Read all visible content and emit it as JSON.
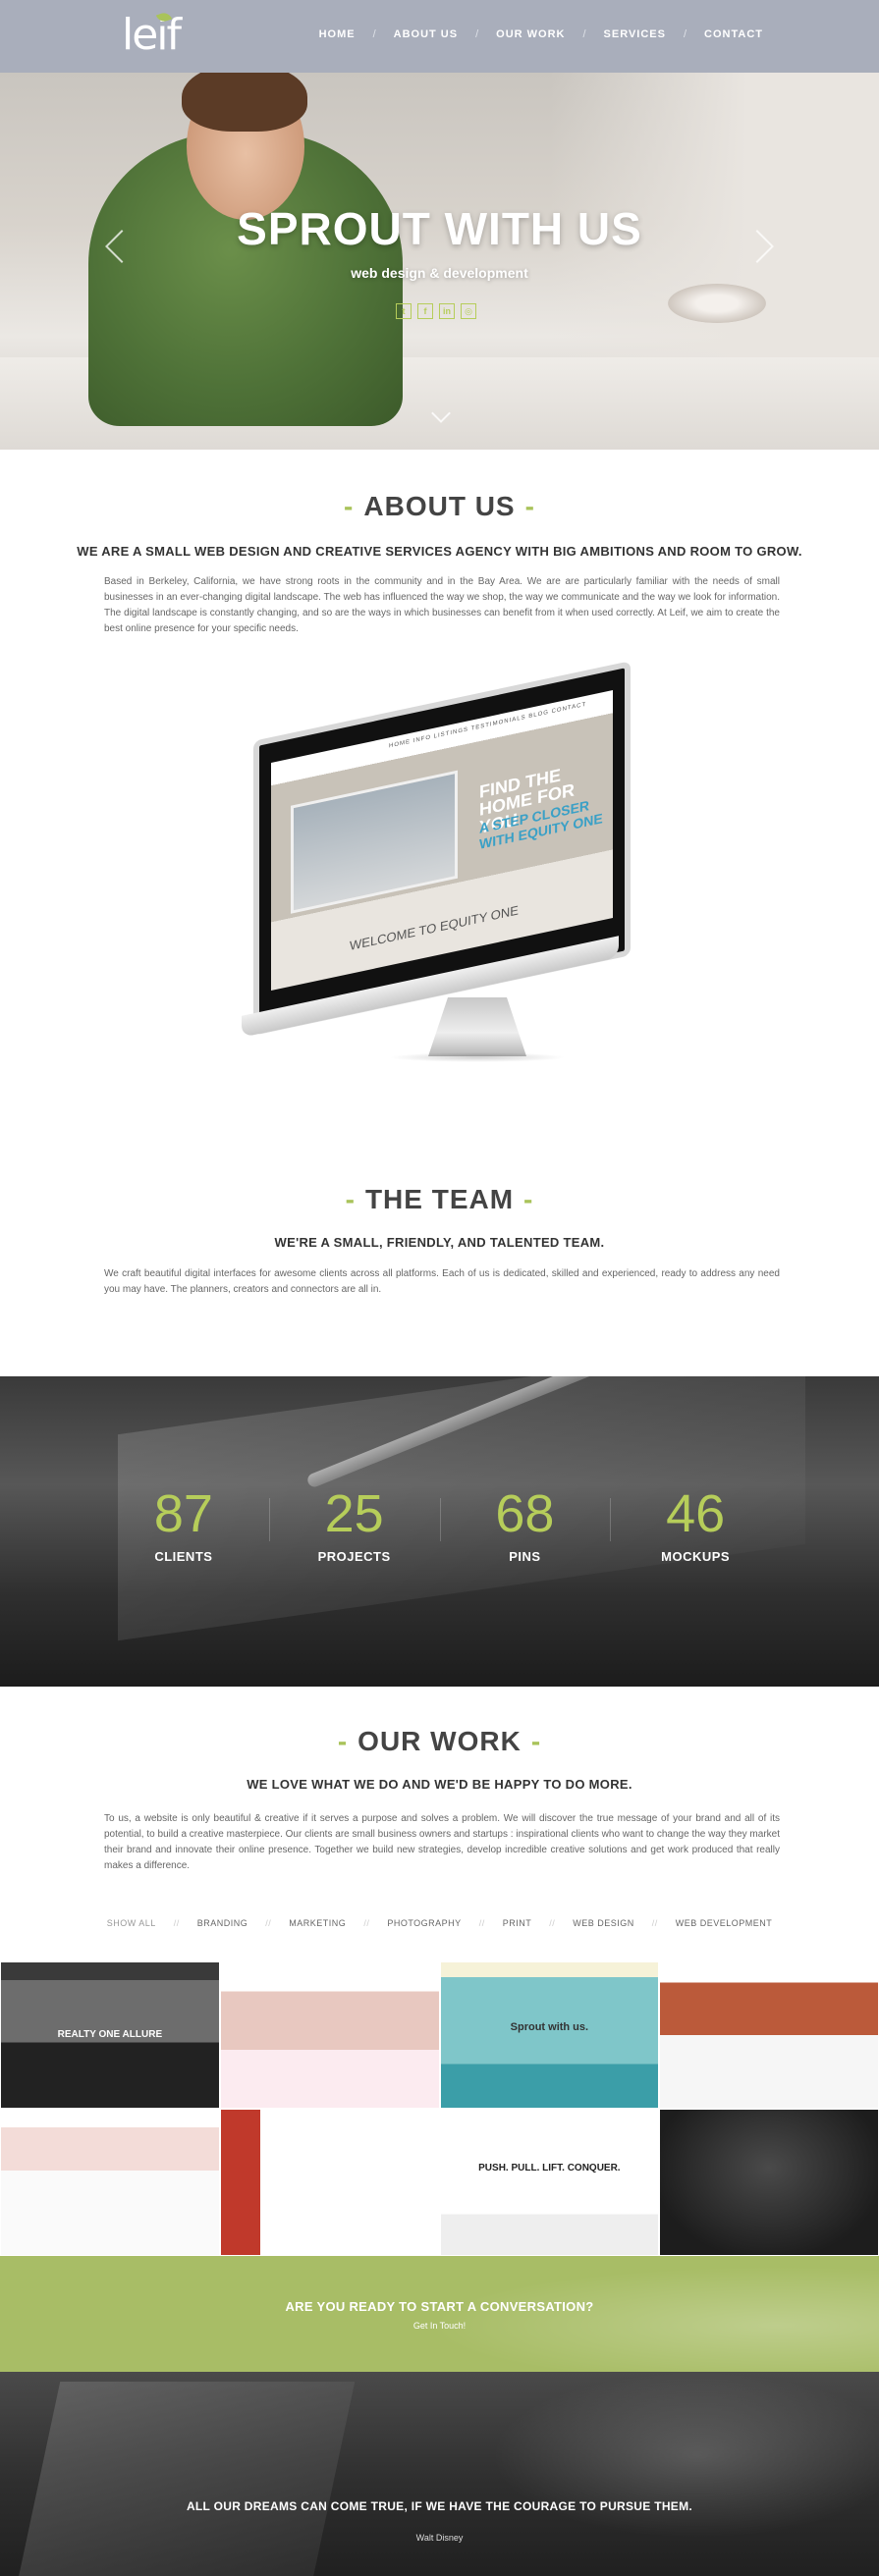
{
  "brand": {
    "logo_text": "leif",
    "accent_color": "#a9c35a"
  },
  "nav": {
    "items": [
      "HOME",
      "ABOUT US",
      "OUR WORK",
      "SERVICES",
      "CONTACT"
    ],
    "separator": "/"
  },
  "hero": {
    "title": "SPROUT WITH US",
    "subtitle": "web design & development",
    "social_icons": [
      "twitter-icon",
      "facebook-icon",
      "linkedin-icon",
      "instagram-icon"
    ],
    "social_glyphs": [
      "t",
      "f",
      "in",
      "◎"
    ]
  },
  "about": {
    "title": "ABOUT US",
    "subtitle": "WE ARE A SMALL WEB DESIGN AND CREATIVE SERVICES AGENCY WITH BIG AMBITIONS AND ROOM TO GROW.",
    "body": "Based in Berkeley, California, we have strong roots in the community and in the Bay Area. We are are particularly familiar with the needs of small businesses in an ever-changing digital landscape. The web has influenced the way we shop, the way we communicate and the way we look for information. The digital landscape is constantly changing, and so are the ways in which businesses can benefit from it when used correctly. At Leif, we aim to create the best online presence for your specific needs.",
    "showcase": {
      "nav": "HOME   INFO   LISTINGS   TESTIMONIALS   BLOG   CONTACT",
      "headline": "FIND THE HOME FOR YOU",
      "tagline": "A STEP CLOSER WITH EQUITY ONE",
      "welcome": "WELCOME TO EQUITY ONE"
    }
  },
  "team": {
    "title": "THE TEAM",
    "subtitle": "WE'RE A SMALL, FRIENDLY, AND TALENTED TEAM.",
    "body": "We craft beautiful digital interfaces for awesome clients across all platforms. Each of us is dedicated, skilled and experienced, ready to address any need you may have. The planners, creators and connectors are all in."
  },
  "stats": [
    {
      "value": "87",
      "label": "CLIENTS"
    },
    {
      "value": "25",
      "label": "PROJECTS"
    },
    {
      "value": "68",
      "label": "PINS"
    },
    {
      "value": "46",
      "label": "MOCKUPS"
    }
  ],
  "work": {
    "title": "OUR WORK",
    "subtitle": "WE LOVE WHAT WE DO AND WE'D BE HAPPY TO DO MORE.",
    "body": "To us, a website is only beautiful & creative if it serves a purpose and solves a problem. We will discover the true message of your brand and all of its potential, to build a creative masterpiece. Our clients are small business owners and startups : inspirational clients who want to change the way they market their brand and innovate their online presence. Together we build new strategies, develop incredible creative solutions and get work produced that really makes a difference.",
    "filters": [
      "SHOW ALL",
      "BRANDING",
      "MARKETING",
      "PHOTOGRAPHY",
      "PRINT",
      "WEB DESIGN",
      "WEB DEVELOPMENT"
    ],
    "tiles": [
      {
        "caption": "REALTY ONE ALLURE"
      },
      {
        "caption": ""
      },
      {
        "caption": "Sprout with us."
      },
      {
        "caption": ""
      },
      {
        "caption": ""
      },
      {
        "caption": ""
      },
      {
        "caption": "PUSH. PULL. LIFT. CONQUER."
      },
      {
        "caption": ""
      }
    ]
  },
  "cta": {
    "title": "ARE YOU READY TO START A CONVERSATION?",
    "link": "Get In Touch!"
  },
  "quote": {
    "text": "ALL OUR DREAMS CAN COME TRUE, IF WE HAVE THE COURAGE TO PURSUE THEM.",
    "author": "Walt Disney"
  }
}
